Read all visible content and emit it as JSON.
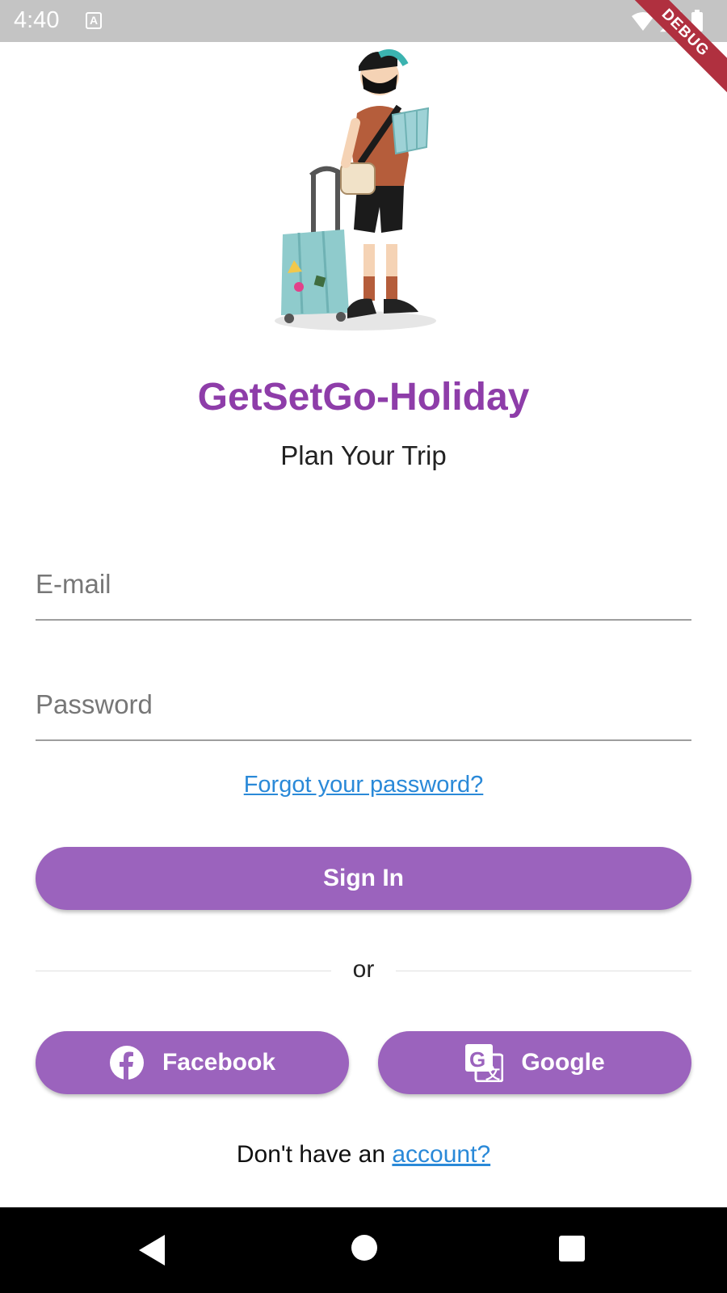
{
  "status_bar": {
    "time": "4:40",
    "debug_label": "DEBUG",
    "icons": [
      "keyboard-a-icon",
      "wifi-icon",
      "signal-icon",
      "battery-icon"
    ]
  },
  "hero": {
    "illustration": "traveler-with-suitcase-illustration"
  },
  "app": {
    "title": "GetSetGo-Holiday",
    "subtitle": "Plan Your Trip"
  },
  "form": {
    "email_placeholder": "E-mail",
    "email_value": "",
    "password_placeholder": "Password",
    "password_value": "",
    "forgot_label": "Forgot your password?",
    "signin_label": "Sign In"
  },
  "divider": {
    "text": "or"
  },
  "social": {
    "facebook_label": "Facebook",
    "google_label": "Google"
  },
  "signup": {
    "prefix": "Don't have an ",
    "link": "account?"
  },
  "colors": {
    "accent": "#9b63bd",
    "title": "#8e3da9",
    "link": "#2a89d8",
    "status_bar": "#c4c4c4",
    "debug_ribbon": "#b0303f"
  },
  "nav_bar": {
    "icons": [
      "back-icon",
      "home-icon",
      "recents-icon"
    ]
  }
}
